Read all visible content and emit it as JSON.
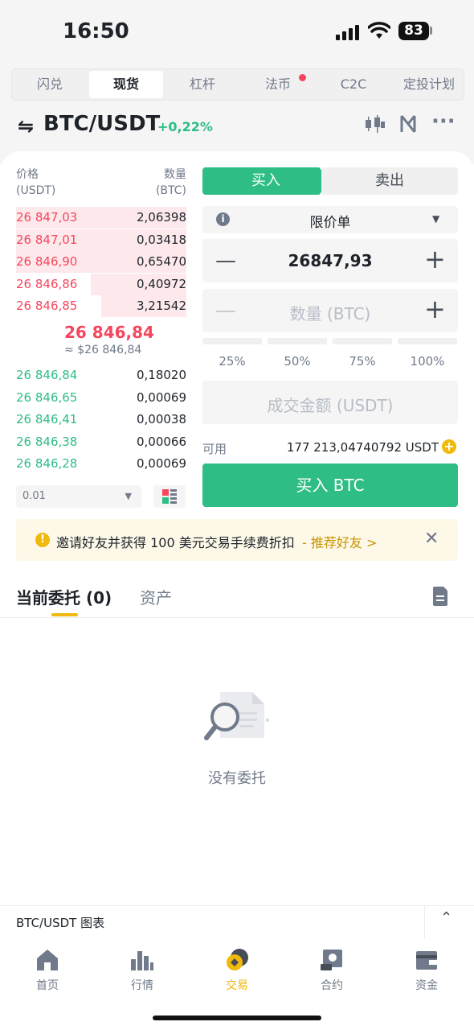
{
  "status_bar": {
    "time": "16:50",
    "battery": "83"
  },
  "tabs": [
    "闪兑",
    "现货",
    "杠杆",
    "法币",
    "C2C",
    "定投计划"
  ],
  "pair": {
    "symbol": "BTC/USDT",
    "change": "+0,22%"
  },
  "order_book": {
    "price_header": "价格",
    "price_unit": "(USDT)",
    "qty_header": "数量",
    "qty_unit": "(BTC)",
    "asks": [
      {
        "price": "26 847,03",
        "qty": "2,06398",
        "depth": 1.0
      },
      {
        "price": "26 847,01",
        "qty": "0,03418",
        "depth": 1.0
      },
      {
        "price": "26 846,90",
        "qty": "0,65470",
        "depth": 1.0
      },
      {
        "price": "26 846,86",
        "qty": "0,40972",
        "depth": 0.56
      },
      {
        "price": "26 846,85",
        "qty": "3,21542",
        "depth": 0.5
      }
    ],
    "last_price": "26 846,84",
    "last_price_usd": "≈ $26 846,84",
    "bids": [
      {
        "price": "26 846,84",
        "qty": "0,18020"
      },
      {
        "price": "26 846,65",
        "qty": "0,00069"
      },
      {
        "price": "26 846,41",
        "qty": "0,00038"
      },
      {
        "price": "26 846,38",
        "qty": "0,00066"
      },
      {
        "price": "26 846,28",
        "qty": "0,00069"
      }
    ],
    "precision": "0.01"
  },
  "trade": {
    "buy_tab": "买入",
    "sell_tab": "卖出",
    "order_type": "限价单",
    "price_value": "26847,93",
    "qty_placeholder": "数量 (BTC)",
    "percents": [
      "25%",
      "50%",
      "75%",
      "100%"
    ],
    "total_placeholder": "成交金额 (USDT)",
    "available_label": "可用",
    "available_value": "177 213,04740792 USDT",
    "buy_button": "买入 BTC"
  },
  "banner": {
    "text": "邀请好友并获得 100 美元交易手续费折扣",
    "link": "- 推荐好友 >"
  },
  "orders": {
    "tab_open": "当前委托 (0)",
    "tab_assets": "资产",
    "empty_text": "没有委托"
  },
  "chart_bar": {
    "label": "BTC/USDT 图表"
  },
  "nav": [
    "首页",
    "行情",
    "交易",
    "合约",
    "资金"
  ],
  "colors": {
    "green": "#2ebd85",
    "red": "#f6465d",
    "accent": "#f0b90b"
  }
}
